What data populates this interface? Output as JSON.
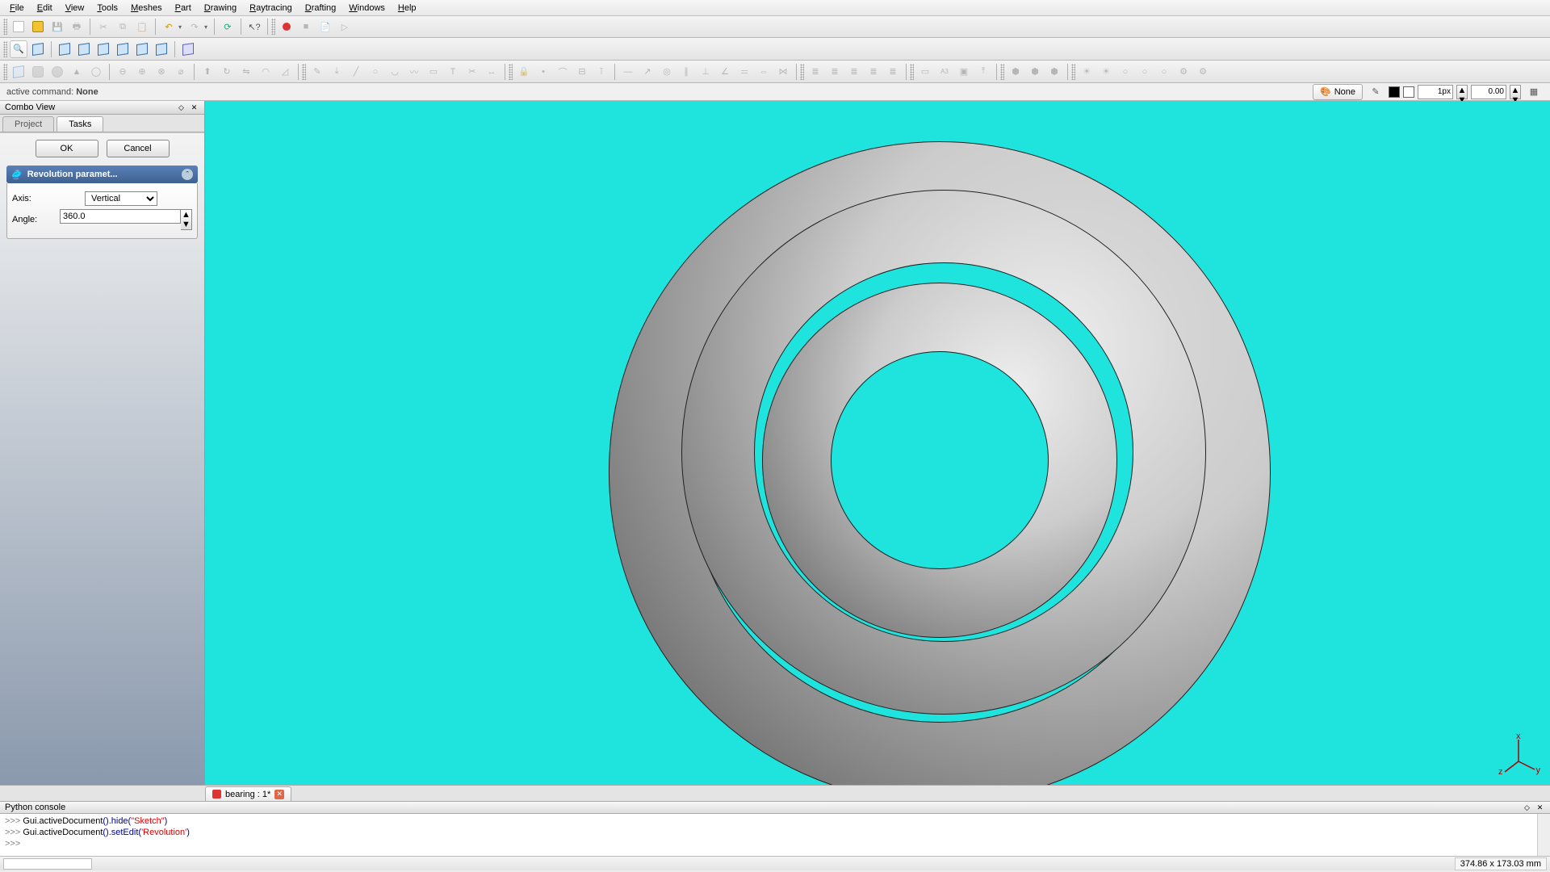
{
  "menu": [
    "File",
    "Edit",
    "View",
    "Tools",
    "Meshes",
    "Part",
    "Drawing",
    "Raytracing",
    "Drafting",
    "Windows",
    "Help"
  ],
  "cmd": {
    "label": "active command:",
    "value": "None"
  },
  "combo": {
    "title": "Combo View",
    "tabs": [
      "Project",
      "Tasks"
    ],
    "ok": "OK",
    "cancel": "Cancel",
    "section": "Revolution paramet...",
    "fields": {
      "axis_label": "Axis:",
      "axis_value": "Vertical",
      "angle_label": "Angle:",
      "angle_value": "360.0"
    }
  },
  "right_tools": {
    "none_btn": "None",
    "px_value": "1px",
    "num_value": "0.00"
  },
  "doc_tab": {
    "label": "bearing : 1*"
  },
  "python": {
    "title": "Python console",
    "lines": [
      {
        "prefix": ">>> ",
        "a": "Gui.activeDocument",
        "mid": "().hide(",
        "str": "\"Sketch\"",
        "end": ")"
      },
      {
        "prefix": ">>> ",
        "a": "Gui.activeDocument",
        "mid": "().setEdit(",
        "str": "'Revolution'",
        "end": ")"
      },
      {
        "prefix": ">>> ",
        "a": "",
        "mid": "",
        "str": "",
        "end": ""
      }
    ]
  },
  "status": {
    "dims": "374.86 x 173.03 mm"
  },
  "axis": {
    "x": "x",
    "y": "y",
    "z": "z"
  }
}
